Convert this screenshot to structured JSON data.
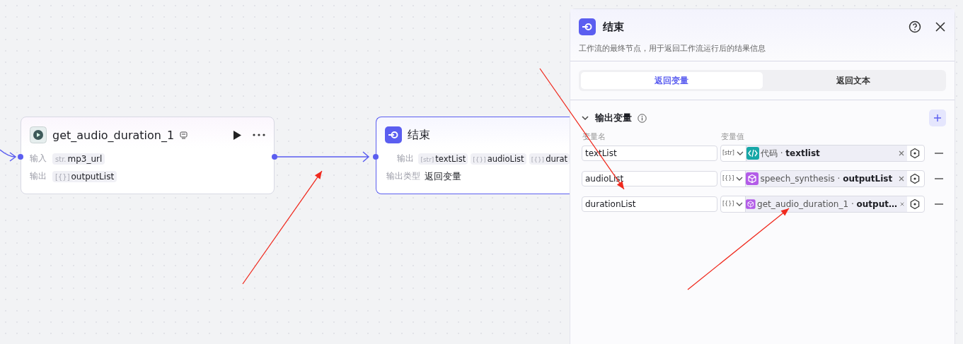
{
  "canvas": {
    "source_node": {
      "title": "get_audio_duration_1",
      "inputs_label": "输入",
      "inputs": [
        {
          "type": "str.",
          "name": "mp3_url"
        }
      ],
      "outputs_label": "输出",
      "outputs": [
        {
          "type": "[{}]",
          "name": "outputList"
        }
      ]
    },
    "end_node": {
      "title": "结束",
      "outputs_label": "输出",
      "outputs": [
        {
          "type": "[str]",
          "name": "textList"
        },
        {
          "type": "[{}]",
          "name": "audioList"
        },
        {
          "type": "[{}]",
          "name": "durat"
        }
      ],
      "output_type_label": "输出类型",
      "output_type": "返回变量"
    }
  },
  "panel": {
    "title": "结束",
    "description": "工作流的最终节点，用于返回工作流运行后的结果信息",
    "tabs": [
      {
        "label": "返回变量",
        "selected": true
      },
      {
        "label": "返回文本",
        "selected": false
      }
    ],
    "section": {
      "title": "输出变量",
      "expanded": true,
      "name_header": "变量名",
      "value_header": "变量值",
      "rows": [
        {
          "name": "textList",
          "type": "[str]",
          "kind": "code",
          "source": "代码 ·",
          "field": "textlist"
        },
        {
          "name": "audioList",
          "type": "[{}]",
          "kind": "node",
          "source": "speech_synthesis ·",
          "field": "outputList"
        },
        {
          "name": "durationList",
          "type": "[{}]",
          "kind": "node",
          "source": "get_audio_duration_1 ·",
          "field": "output…"
        }
      ]
    }
  }
}
